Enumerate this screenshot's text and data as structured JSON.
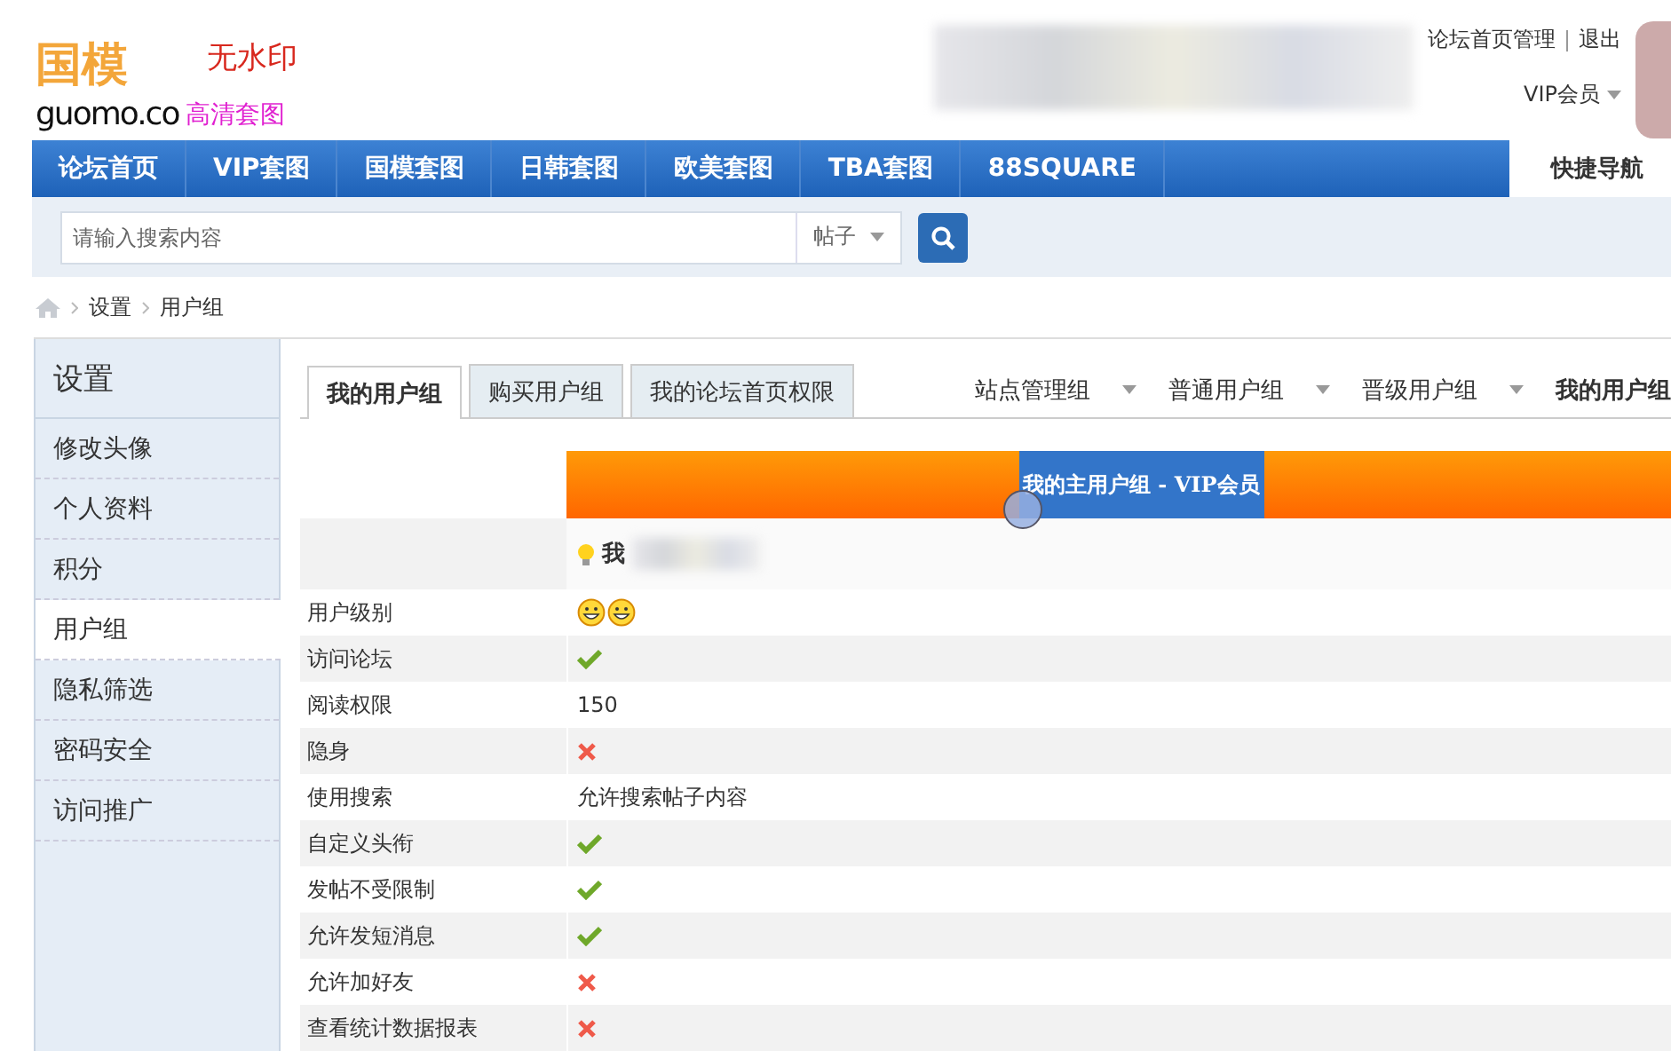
{
  "logo": {
    "mark": "国模",
    "site": "guomo.co",
    "tag_top": "无水印",
    "tag_bottom": "高清套图"
  },
  "user_links": [
    "论坛首页管理",
    "退出"
  ],
  "user_group": "VIP会员",
  "nav": [
    {
      "label": "论坛首页",
      "selected": false
    },
    {
      "label": "VIP套图",
      "selected": false
    },
    {
      "label": "国模套图",
      "selected": false
    },
    {
      "label": "日韩套图",
      "selected": false
    },
    {
      "label": "欧美套图",
      "selected": false
    },
    {
      "label": "TBA套图",
      "selected": false
    },
    {
      "label": "88SQUARE",
      "selected": false
    }
  ],
  "quick_nav": "快捷导航",
  "search": {
    "placeholder": "请输入搜索内容",
    "scope": "帖子"
  },
  "breadcrumb": [
    "设置",
    "用户组"
  ],
  "sidebar": {
    "title": "设置",
    "items": [
      {
        "label": "修改头像",
        "selected": false
      },
      {
        "label": "个人资料",
        "selected": false
      },
      {
        "label": "积分",
        "selected": false
      },
      {
        "label": "用户组",
        "selected": true
      },
      {
        "label": "隐私筛选",
        "selected": false
      },
      {
        "label": "密码安全",
        "selected": false
      },
      {
        "label": "访问推广",
        "selected": false
      }
    ]
  },
  "tabs": [
    {
      "label": "我的用户组",
      "selected": true
    },
    {
      "label": "购买用户组",
      "selected": false
    },
    {
      "label": "我的论坛首页权限",
      "selected": false
    }
  ],
  "group_filters": [
    {
      "label": "站点管理组",
      "selected": false
    },
    {
      "label": "普通用户组",
      "selected": false
    },
    {
      "label": "晋级用户组",
      "selected": false
    },
    {
      "label": "我的用户组",
      "selected": true
    }
  ],
  "banner": "我的主用户组 - VIP会员",
  "group_name": "我",
  "rows": [
    {
      "label": "用户级别",
      "kind": "level-icons"
    },
    {
      "label": "访问论坛",
      "kind": "yes"
    },
    {
      "label": "阅读权限",
      "kind": "text",
      "value": "150"
    },
    {
      "label": "隐身",
      "kind": "no"
    },
    {
      "label": "使用搜索",
      "kind": "text",
      "value": "允许搜索帖子内容"
    },
    {
      "label": "自定义头衔",
      "kind": "yes"
    },
    {
      "label": "发帖不受限制",
      "kind": "yes"
    },
    {
      "label": "允许发短消息",
      "kind": "yes"
    },
    {
      "label": "允许加好友",
      "kind": "no"
    },
    {
      "label": "查看统计数据报表",
      "kind": "no"
    }
  ]
}
